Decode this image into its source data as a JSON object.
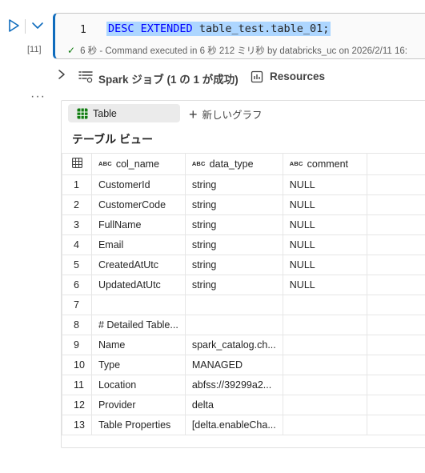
{
  "cell": {
    "execution_count": "[11]",
    "line_number": "1",
    "code": {
      "kw1": "DESC",
      "kw2": "EXTENDED",
      "target": "table_test.table_01;"
    },
    "status_text": "6 秒 - Command executed in 6 秒 212 ミリ秒 by databricks_uc on 2026/2/11 16:"
  },
  "jobs": {
    "label": "Spark ジョブ (1 の 1 が成功)",
    "resources_label": "Resources"
  },
  "output": {
    "tab_label": "Table",
    "new_graph_label": "新しいグラフ",
    "view_title": "テーブル ビュー",
    "type_badge": "ABC",
    "columns": [
      "col_name",
      "data_type",
      "comment"
    ],
    "rows": [
      {
        "n": "1",
        "col_name": "CustomerId",
        "data_type": "string",
        "comment": "NULL"
      },
      {
        "n": "2",
        "col_name": "CustomerCode",
        "data_type": "string",
        "comment": "NULL"
      },
      {
        "n": "3",
        "col_name": "FullName",
        "data_type": "string",
        "comment": "NULL"
      },
      {
        "n": "4",
        "col_name": "Email",
        "data_type": "string",
        "comment": "NULL"
      },
      {
        "n": "5",
        "col_name": "CreatedAtUtc",
        "data_type": "string",
        "comment": "NULL"
      },
      {
        "n": "6",
        "col_name": "UpdatedAtUtc",
        "data_type": "string",
        "comment": "NULL"
      },
      {
        "n": "7",
        "col_name": "",
        "data_type": "",
        "comment": ""
      },
      {
        "n": "8",
        "col_name": "# Detailed Table...",
        "data_type": "",
        "comment": ""
      },
      {
        "n": "9",
        "col_name": "Name",
        "data_type": "spark_catalog.ch...",
        "comment": ""
      },
      {
        "n": "10",
        "col_name": "Type",
        "data_type": "MANAGED",
        "comment": ""
      },
      {
        "n": "11",
        "col_name": "Location",
        "data_type": "abfss://39299a2...",
        "comment": ""
      },
      {
        "n": "12",
        "col_name": "Provider",
        "data_type": "delta",
        "comment": ""
      },
      {
        "n": "13",
        "col_name": "Table Properties",
        "data_type": "[delta.enableCha...",
        "comment": ""
      }
    ]
  },
  "colors": {
    "accent": "#0f6cbd",
    "success": "#107c10",
    "selection": "#add6ff",
    "table_icon": "#107c10"
  }
}
